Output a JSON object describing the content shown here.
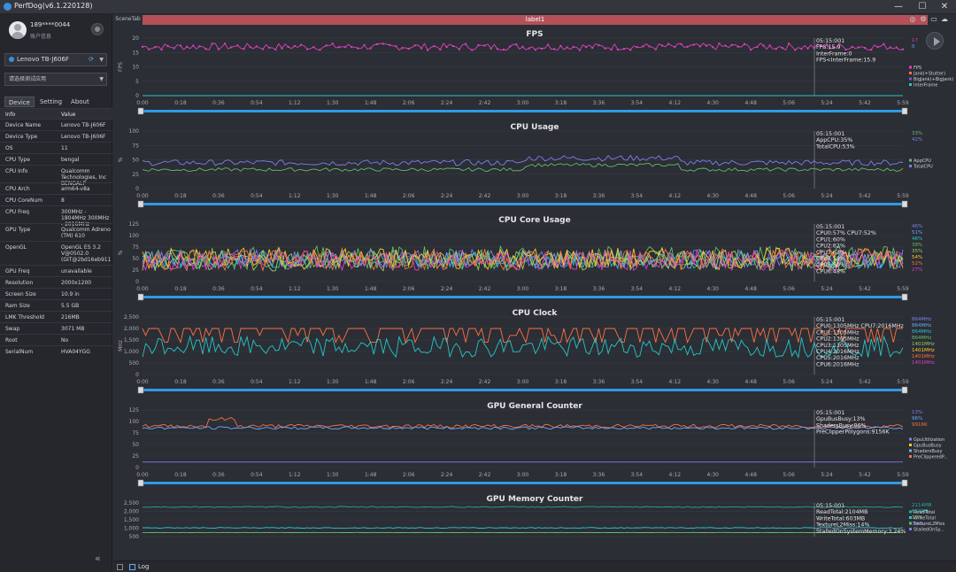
{
  "window": {
    "title": "PerfDog(v6.1.220128)",
    "minimize": "—",
    "maximize": "☐",
    "close": "✕"
  },
  "user": {
    "name": "189****0044",
    "sub": "账户信息"
  },
  "device": {
    "selected": "Lenovo TB-J606F"
  },
  "app": {
    "placeholder": "请选择测试应用"
  },
  "tabs": [
    {
      "label": "Device"
    },
    {
      "label": "Setting"
    },
    {
      "label": "About"
    }
  ],
  "info_header": {
    "k": "Info",
    "v": "Value"
  },
  "info": [
    {
      "k": "Device Name",
      "v": "Lenovo TB-J606F"
    },
    {
      "k": "Device Type",
      "v": "Lenovo TB-J606F"
    },
    {
      "k": "OS",
      "v": "11"
    },
    {
      "k": "CPU Type",
      "v": "bengal"
    },
    {
      "k": "CPU Info",
      "v": "Qualcomm Technologies, Inc BENGALP"
    },
    {
      "k": "CPU Arch",
      "v": "arm64-v8a"
    },
    {
      "k": "CPU CoreNum",
      "v": "8"
    },
    {
      "k": "CPU Freq",
      "v": "300MHz - 1804MHz 300MHz - 2016MHz"
    },
    {
      "k": "GPU Type",
      "v": "Qualcomm Adreno (TM) 610"
    },
    {
      "k": "OpenGL",
      "v": "OpenGL ES 3.2 V@0502.0 (GIT@2bd16eb911"
    },
    {
      "k": "GPU Freq",
      "v": "unavailable"
    },
    {
      "k": "Resolution",
      "v": "2000x1200"
    },
    {
      "k": "Screen Size",
      "v": "10.9 in"
    },
    {
      "k": "Ram Size",
      "v": "5.5 GB"
    },
    {
      "k": "LMK Threshold",
      "v": "216MB"
    },
    {
      "k": "Swap",
      "v": "3071 MB"
    },
    {
      "k": "Root",
      "v": "No"
    },
    {
      "k": "SerialNum",
      "v": "HVA04YGG"
    }
  ],
  "scene": {
    "tab": "SceneTab",
    "label": "label1"
  },
  "bottom": {
    "log": "Log"
  },
  "x_ticks": [
    "0:00",
    "0:18",
    "0:36",
    "0:54",
    "1:12",
    "1:30",
    "1:48",
    "2:06",
    "2:24",
    "2:42",
    "3:00",
    "3:18",
    "3:36",
    "3:54",
    "4:12",
    "4:30",
    "4:48",
    "5:06",
    "5:24",
    "5:42",
    "5:59"
  ],
  "chart_data": [
    {
      "type": "line",
      "title": "FPS",
      "ylabel": "FPS",
      "yticks": [
        "20",
        "15",
        "10",
        "5",
        "0"
      ],
      "ylim": [
        0,
        20
      ],
      "tooltip": [
        "05:15:001",
        "FPS:15.9",
        "InterFrame:0",
        "FPS<InterFrame:15.9"
      ],
      "right_values": [
        {
          "text": "17",
          "color": "#e040c0"
        },
        {
          "text": "0",
          "color": "#6aa9ff"
        }
      ],
      "legend": [
        {
          "name": "FPS",
          "color": "#e040c0"
        },
        {
          "name": "Jank(+Stutter)",
          "color": "#ff7043"
        },
        {
          "name": "BigJank(+BigJank)",
          "color": "#7e57c2"
        },
        {
          "name": "InterFrame",
          "color": "#26c6c6"
        }
      ],
      "series": [
        {
          "name": "FPS",
          "color": "#e040c0",
          "base": 17,
          "noise": 1.2,
          "markers": true
        },
        {
          "name": "InterFrame",
          "color": "#26c6c6",
          "base": 0,
          "noise": 0
        }
      ]
    },
    {
      "type": "line",
      "title": "CPU Usage",
      "ylabel": "%",
      "yticks": [
        "100",
        "75",
        "50",
        "25",
        "0"
      ],
      "ylim": [
        0,
        100
      ],
      "tooltip": [
        "05:15:001",
        "AppCPU:35%",
        "TotalCPU:53%"
      ],
      "right_values": [
        {
          "text": "33%",
          "color": "#66bb6a"
        },
        {
          "text": "42%",
          "color": "#7e7ef0"
        }
      ],
      "legend": [
        {
          "name": "AppCPU",
          "color": "#66bb6a"
        },
        {
          "name": "TotalCPU",
          "color": "#7e7ef0"
        }
      ],
      "series": [
        {
          "name": "TotalCPU",
          "color": "#7e7ef0",
          "base": 45,
          "noise": 5
        },
        {
          "name": "AppCPU",
          "color": "#66bb6a",
          "base": 33,
          "noise": 3
        }
      ]
    },
    {
      "type": "line",
      "title": "CPU Core Usage",
      "ylabel": "%",
      "yticks": [
        "125",
        "100",
        "75",
        "50",
        "25",
        "0"
      ],
      "ylim": [
        0,
        125
      ],
      "tooltip": [
        "05:15:001",
        "CPU0:57% CPU7:52%",
        "CPU1:60%",
        "CPU2:62%",
        "CPU3:63%",
        "CPU4:58%",
        "CPU5:50%",
        "CPU6:48%"
      ],
      "right_values": [
        {
          "text": "46%",
          "color": "#7e7ef0"
        },
        {
          "text": "51%",
          "color": "#6aa9ff"
        },
        {
          "text": "46%",
          "color": "#26c6c6"
        },
        {
          "text": "39%",
          "color": "#66bb6a"
        },
        {
          "text": "35%",
          "color": "#9ccc65"
        },
        {
          "text": "54%",
          "color": "#ffca28"
        },
        {
          "text": "52%",
          "color": "#ff7043"
        },
        {
          "text": "27%",
          "color": "#e040c0"
        }
      ],
      "legend": [],
      "series": [
        {
          "name": "CPU0",
          "color": "#7e7ef0",
          "base": 50,
          "noise": 20
        },
        {
          "name": "CPU1",
          "color": "#6aa9ff",
          "base": 48,
          "noise": 20
        },
        {
          "name": "CPU2",
          "color": "#26c6c6",
          "base": 46,
          "noise": 18
        },
        {
          "name": "CPU3",
          "color": "#66bb6a",
          "base": 52,
          "noise": 25
        },
        {
          "name": "CPU4",
          "color": "#9ccc65",
          "base": 45,
          "noise": 22
        },
        {
          "name": "CPU5",
          "color": "#ffca28",
          "base": 50,
          "noise": 24
        },
        {
          "name": "CPU6",
          "color": "#ff7043",
          "base": 48,
          "noise": 24
        },
        {
          "name": "CPU7",
          "color": "#e040c0",
          "base": 46,
          "noise": 22
        }
      ]
    },
    {
      "type": "line",
      "title": "CPU Clock",
      "ylabel": "MHz",
      "yticks": [
        "2,500",
        "2,000",
        "1,500",
        "1,000",
        "500",
        "0"
      ],
      "ylim": [
        0,
        2500
      ],
      "tooltip": [
        "05:15:001",
        "CPU0:1305MHz CPU7:2016MHz",
        "CPU1:1305MHz",
        "CPU2:1305MHz",
        "CPU3:1305MHz",
        "CPU4:2016MHz",
        "CPU5:2016MHz",
        "CPU6:2016MHz"
      ],
      "right_values": [
        {
          "text": "864MHz",
          "color": "#7e7ef0"
        },
        {
          "text": "864MHz",
          "color": "#6aa9ff"
        },
        {
          "text": "864MHz",
          "color": "#26c6c6"
        },
        {
          "text": "864MHz",
          "color": "#66bb6a"
        },
        {
          "text": "1401MHz",
          "color": "#9ccc65"
        },
        {
          "text": "1401MHz",
          "color": "#ffca28"
        },
        {
          "text": "1401MHz",
          "color": "#ff7043"
        },
        {
          "text": "1401MHz",
          "color": "#e040c0"
        }
      ],
      "legend": [],
      "series": [
        {
          "name": "CPU4-7",
          "color": "#ff7043",
          "base": 1750,
          "noise": 350,
          "step": true
        },
        {
          "name": "CPU0-3",
          "color": "#26c6c6",
          "base": 1200,
          "noise": 450
        }
      ]
    },
    {
      "type": "line",
      "title": "GPU General Counter",
      "ylabel": "",
      "yticks": [
        "125",
        "100",
        "75",
        "50",
        "25",
        "0"
      ],
      "ylim": [
        0,
        125
      ],
      "tooltip": [
        "05:15:001",
        "GpuBusBusy:13%",
        "ShadersBusy:96%",
        "PreClipperPolygons:9156K"
      ],
      "right_values": [
        {
          "text": "13%",
          "color": "#7e7ef0"
        },
        {
          "text": "96%",
          "color": "#6aa9ff"
        },
        {
          "text": "9916K",
          "color": "#ff7043"
        }
      ],
      "legend": [
        {
          "name": "GpuUtilization",
          "color": "#7e7ef0"
        },
        {
          "name": "GpuBusBusy",
          "color": "#ffca28"
        },
        {
          "name": "ShadersBusy",
          "color": "#6aa9ff"
        },
        {
          "name": "PreClipperedP...",
          "color": "#ff7043"
        }
      ],
      "series": [
        {
          "name": "PreClipperPolygons",
          "color": "#ff7043",
          "base": 90,
          "noise": 4
        },
        {
          "name": "ShadersBusy",
          "color": "#6aa9ff",
          "base": 86,
          "noise": 3
        },
        {
          "name": "GpuBusBusy",
          "color": "#7e7ef0",
          "base": 12,
          "noise": 0
        }
      ]
    },
    {
      "type": "line",
      "title": "GPU Memory Counter",
      "ylabel": "",
      "yticks": [
        "2,500",
        "2,000",
        "1,500",
        "1,000",
        "500"
      ],
      "ylim": [
        0,
        2500
      ],
      "tooltip": [
        "05:15:001",
        "ReadTotal:2104MB",
        "WriteTotal:603MB",
        "TextureL2Miss:14%",
        "StalledOnSystemMemory:3.24%"
      ],
      "right_values": [
        {
          "text": "2114MB",
          "color": "#26a69a"
        },
        {
          "text": "674MB",
          "color": "#26c6c6"
        },
        {
          "text": "13%",
          "color": "#66bb6a"
        },
        {
          "text": "3.4%",
          "color": "#7e7ef0"
        }
      ],
      "legend": [
        {
          "name": "ReadTotal",
          "color": "#26a69a"
        },
        {
          "name": "WriteTotal",
          "color": "#26c6c6"
        },
        {
          "name": "TextureL2Miss",
          "color": "#66bb6a"
        },
        {
          "name": "StalledOnSy...",
          "color": "#7e7ef0"
        }
      ],
      "series": [
        {
          "name": "ReadTotal",
          "color": "#26a69a",
          "base": 2200,
          "noise": 40
        },
        {
          "name": "WriteTotal",
          "color": "#26c6c6",
          "base": 650,
          "noise": 30
        },
        {
          "name": "TextureL2Miss",
          "color": "#66bb6a",
          "base": 300,
          "noise": 10
        }
      ]
    }
  ]
}
